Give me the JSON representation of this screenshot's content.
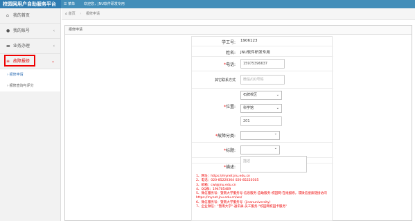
{
  "app": {
    "title": "校园网用户自助服务平台",
    "menu_icon": "menu-icon",
    "menu_label": "菜单",
    "welcome": "欢迎您，JNU软件研发专用"
  },
  "sidebar": {
    "items": [
      {
        "label": "我的首页",
        "icon": "home-icon"
      },
      {
        "label": "我的账号",
        "icon": "user-icon"
      },
      {
        "label": "业务办理",
        "icon": "briefcase-icon"
      },
      {
        "label": "故障报修",
        "icon": "list-icon"
      }
    ],
    "sub_items": [
      {
        "label": "报修申请"
      },
      {
        "label": "报修查询与评分"
      }
    ]
  },
  "breadcrumb": {
    "home": "首页",
    "current": "报修申请"
  },
  "panel": {
    "title": "报修申请"
  },
  "form": {
    "student_id": {
      "label": "学工号:",
      "value": "1906123"
    },
    "name": {
      "label": "姓名:",
      "value": "JNU软件研发专用"
    },
    "phone": {
      "label": "电话:",
      "value": "15975396637"
    },
    "other_contact": {
      "label": "其它联系方式",
      "placeholder": "微信/QQ号码"
    },
    "location": {
      "label": "位置:",
      "campus": "石牌校区",
      "building": "科学馆",
      "room": "201"
    },
    "fault_type": {
      "label": "故障分类:"
    },
    "title": {
      "label": "标题:"
    },
    "description": {
      "label": "描述:",
      "placeholder": "描述"
    }
  },
  "info_lines": [
    "1、网址：https://mynet.jnu.edu.cn",
    "2、电话：020-85220304 020-85220305",
    "3、邮箱：cwl@jnu.edu.cn",
    "4、QQ群：194705469",
    "5、微信服务号：暨南大学服务号-信息服务-自助服务-校园网-在线报修，或微信搜索链接访问",
    "https://mynet.jnu.edu.cn/wx/",
    "6、微信服务号：暨南大学服务号（jinanuniversity）",
    "7、企业微信：\"暨南大学\"-通讯录-员工服务-\"校园网校园卡服务\""
  ]
}
